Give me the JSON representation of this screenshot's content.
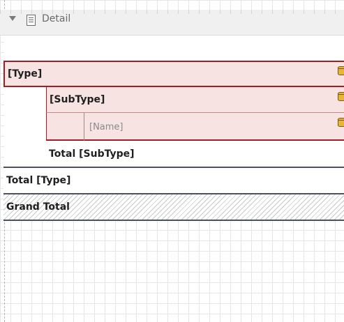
{
  "band": {
    "title": "Detail"
  },
  "rows": {
    "type": "[Type]",
    "subtype": "[SubType]",
    "name": "[Name]",
    "total_subtype": "Total [SubType]",
    "total_type": "Total [Type]",
    "grand_total": "Grand Total"
  },
  "icons": {
    "collapse": "triangle-down-icon",
    "band": "detail-band-icon",
    "field": "database-field-icon"
  },
  "colors": {
    "group_border": "#a61c24",
    "group_fill": "#f8e3e3",
    "total_border": "#4a5260",
    "field_icon": "#e7b53a"
  }
}
